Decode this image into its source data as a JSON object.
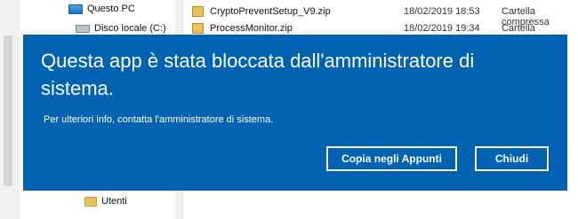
{
  "explorer": {
    "nav_items": [
      "Questo PC",
      "Disco locale (C:)",
      "Utenti"
    ],
    "files": [
      {
        "name": "CryptoPreventSetup_V9.zip",
        "date": "18/02/2019 18:53",
        "type": "Cartella compressa"
      },
      {
        "name": "ProcessMonitor.zip",
        "date": "18/02/2019 19:34",
        "type": "Cartella compressa"
      }
    ]
  },
  "dialog": {
    "title": "Questa app è stata bloccata dall'amministratore di sistema.",
    "subtitle": "Per ulteriori info, contatta l'amministratore di sistema.",
    "copy_button": "Copia negli Appunti",
    "close_button": "Chiudi",
    "accent_color": "#0063b1"
  }
}
